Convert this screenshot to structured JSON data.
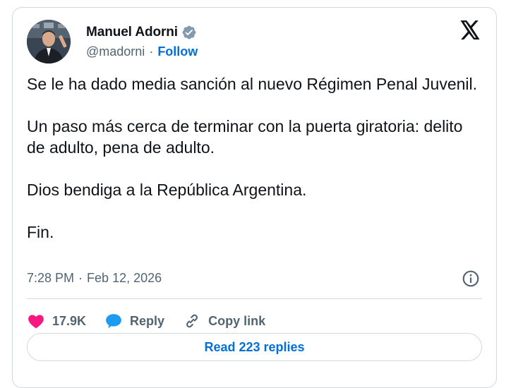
{
  "author": {
    "display_name": "Manuel Adorni",
    "handle": "@madorni",
    "separator": "·",
    "follow_label": "Follow",
    "verified_color": "#829aab"
  },
  "tweet": {
    "paragraphs": [
      "Se le ha dado media sanción al nuevo Régimen Penal Juvenil.",
      "Un paso más cerca de terminar con la puerta giratoria: delito de adulto, pena de adulto.",
      "Dios bendiga a la República Argentina.",
      "Fin."
    ],
    "time": "7:28 PM",
    "separator": "·",
    "date": "Feb 12, 2026"
  },
  "actions": {
    "like_count": "17.9K",
    "reply_label": "Reply",
    "copy_link_label": "Copy link"
  },
  "footer": {
    "read_replies_label": "Read 223 replies"
  },
  "icons": {
    "like": "heart-icon",
    "reply": "speech-bubble-icon",
    "copy_link": "link-icon",
    "info": "info-icon",
    "brand": "x-logo-icon",
    "verified": "verified-badge-icon"
  },
  "colors": {
    "like": "#f91880",
    "reply": "#1d9bf0",
    "link": "#006fd6",
    "secondary_text": "#536471",
    "border": "#cfd9de"
  }
}
